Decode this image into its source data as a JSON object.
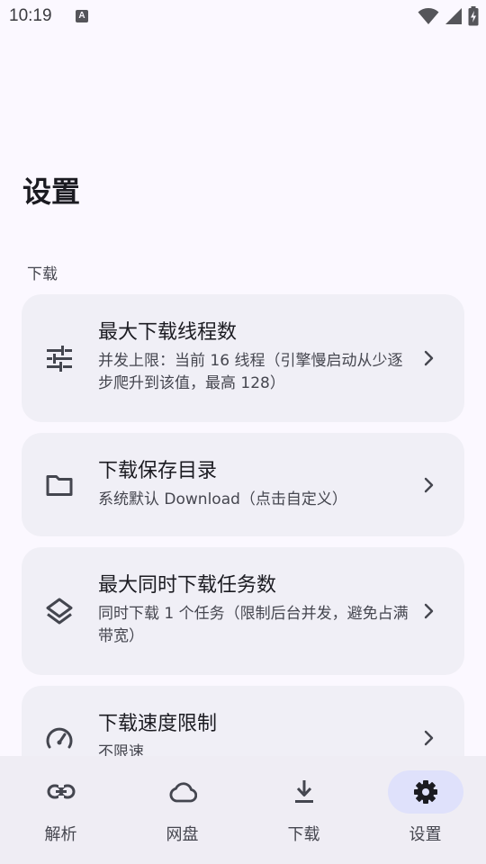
{
  "status_bar": {
    "time": "10:19",
    "notification_letter": "A"
  },
  "page": {
    "title": "设置"
  },
  "sections": [
    {
      "label": "下载",
      "items": [
        {
          "icon": "sliders-icon",
          "title": "最大下载线程数",
          "subtitle": "并发上限：当前 16 线程（引擎慢启动从少逐步爬升到该值，最高 128）"
        },
        {
          "icon": "folder-icon",
          "title": "下载保存目录",
          "subtitle": "系统默认 Download（点击自定义）"
        },
        {
          "icon": "layers-icon",
          "title": "最大同时下载任务数",
          "subtitle": "同时下载 1 个任务（限制后台并发，避免占满带宽）"
        },
        {
          "icon": "speedometer-icon",
          "title": "下载速度限制",
          "subtitle": "不限速"
        }
      ]
    }
  ],
  "nav": {
    "items": [
      {
        "label": "解析",
        "icon": "link-icon",
        "active": false
      },
      {
        "label": "网盘",
        "icon": "cloud-icon",
        "active": false
      },
      {
        "label": "下载",
        "icon": "download-icon",
        "active": false
      },
      {
        "label": "设置",
        "icon": "gear-icon",
        "active": true
      }
    ]
  },
  "colors": {
    "background": "#fbf8ff",
    "card": "#f0eff6",
    "nav_bar": "#efedf4",
    "nav_active_pill": "#dfe1fb",
    "primary_text": "#1b1b21",
    "secondary_text": "#45464f",
    "icon": "#44464f"
  }
}
